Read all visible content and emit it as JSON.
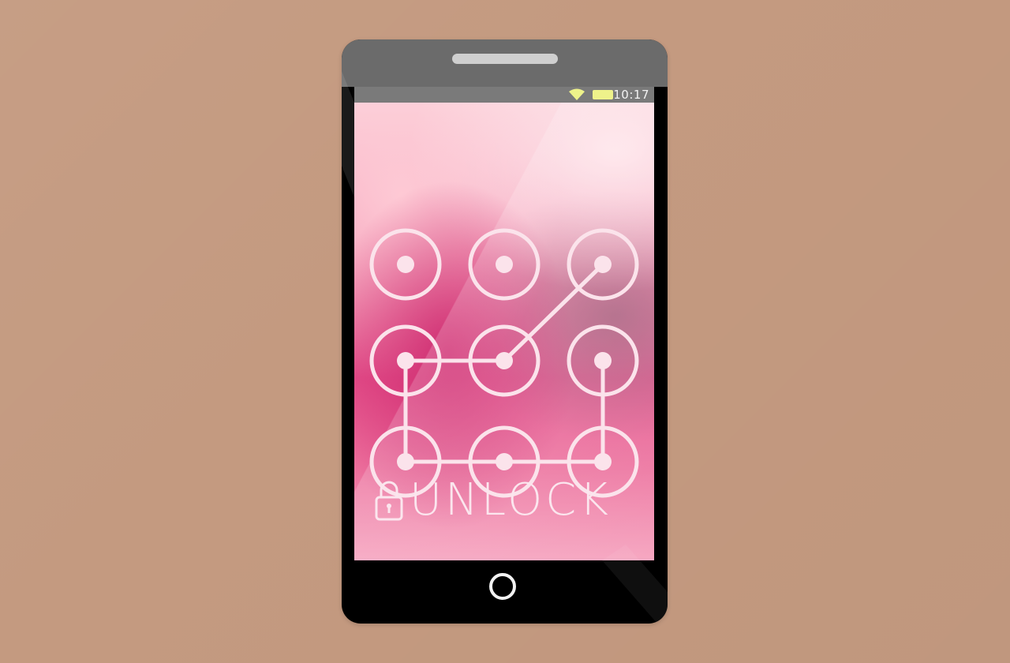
{
  "status_bar": {
    "time": "10:17",
    "wifi_icon": "wifi-icon",
    "battery_icon": "battery-icon"
  },
  "lock_screen": {
    "label": "UNLOCK",
    "lock_icon": "padlock-icon",
    "pattern_grid": {
      "rows": 3,
      "cols": 3,
      "drawn_path": [
        3,
        5,
        4,
        7,
        8,
        9,
        6
      ]
    }
  },
  "hardware": {
    "home_button": "home-button",
    "speaker": "speaker-grille"
  },
  "colors": {
    "background": "#c49a80",
    "bezel": "#000000",
    "bezel_top": "#6b6b6b",
    "status_bar": "#7a7a7a",
    "accent_icon": "#eef28a",
    "pattern_stroke": "#fbe3eb"
  }
}
